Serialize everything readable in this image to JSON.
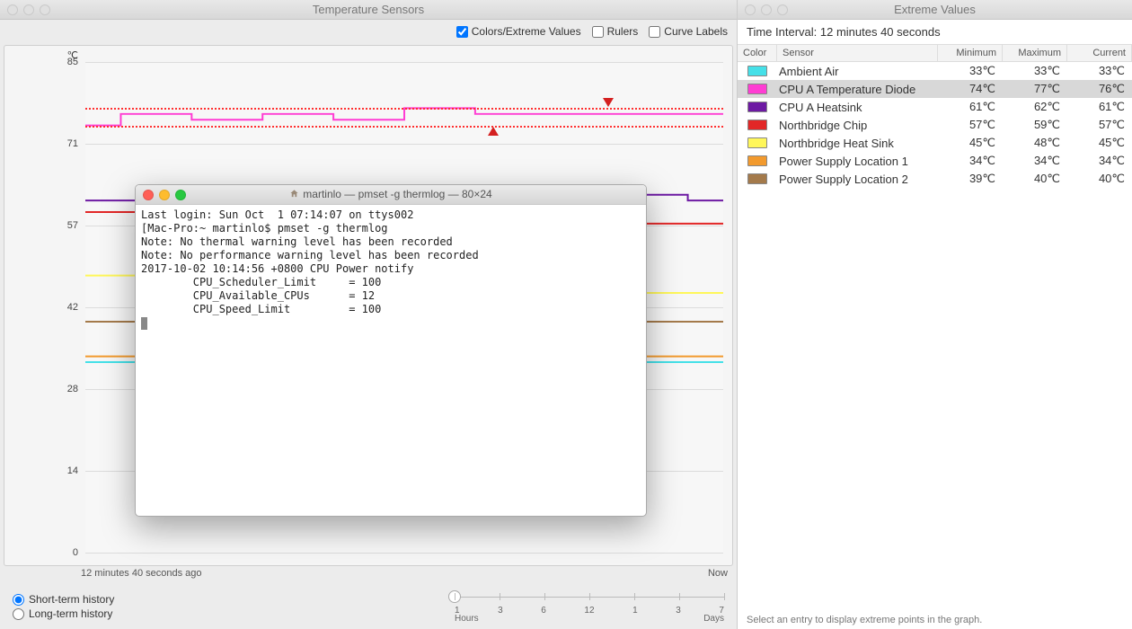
{
  "sensors_window": {
    "title": "Temperature Sensors",
    "checkboxes": {
      "colors_extreme": {
        "label": "Colors/Extreme Values",
        "checked": true
      },
      "rulers": {
        "label": "Rulers",
        "checked": false
      },
      "curve_labels": {
        "label": "Curve Labels",
        "checked": false
      }
    },
    "y_unit": "℃",
    "y_ticks": [
      "85",
      "71",
      "57",
      "42",
      "28",
      "14",
      "0"
    ],
    "x_left": "12 minutes 40 seconds ago",
    "x_right": "Now",
    "history": {
      "short": "Short-term history",
      "long": "Long-term history"
    },
    "timeline": {
      "hours_label": "Hours",
      "days_label": "Days",
      "ticks": [
        "1",
        "3",
        "6",
        "12",
        "1",
        "3",
        "7"
      ]
    }
  },
  "extreme_window": {
    "title": "Extreme Values",
    "interval_label": "Time Interval: 12 minutes 40 seconds",
    "columns": {
      "color": "Color",
      "sensor": "Sensor",
      "min": "Minimum",
      "max": "Maximum",
      "cur": "Current"
    },
    "rows": [
      {
        "color": "#45e0e8",
        "name": "Ambient Air",
        "min": "33℃",
        "max": "33℃",
        "cur": "33℃",
        "selected": false
      },
      {
        "color": "#ff3dd3",
        "name": "CPU A Temperature Diode",
        "min": "74℃",
        "max": "77℃",
        "cur": "76℃",
        "selected": true
      },
      {
        "color": "#6d1aa3",
        "name": "CPU A Heatsink",
        "min": "61℃",
        "max": "62℃",
        "cur": "61℃",
        "selected": false
      },
      {
        "color": "#e22727",
        "name": "Northbridge Chip",
        "min": "57℃",
        "max": "59℃",
        "cur": "57℃",
        "selected": false
      },
      {
        "color": "#fff75a",
        "name": "Northbridge Heat Sink",
        "min": "45℃",
        "max": "48℃",
        "cur": "45℃",
        "selected": false
      },
      {
        "color": "#f29a2e",
        "name": "Power Supply Location 1",
        "min": "34℃",
        "max": "34℃",
        "cur": "34℃",
        "selected": false
      },
      {
        "color": "#a47a4b",
        "name": "Power Supply Location 2",
        "min": "39℃",
        "max": "40℃",
        "cur": "40℃",
        "selected": false
      }
    ],
    "footer": "Select an entry to display extreme points in the graph."
  },
  "terminal": {
    "title": "martinlo — pmset -g thermlog — 80×24",
    "lines": [
      "Last login: Sun Oct  1 07:14:07 on ttys002",
      "[Mac-Pro:~ martinlo$ pmset -g thermlog",
      "Note: No thermal warning level has been recorded",
      "Note: No performance warning level has been recorded",
      "2017-10-02 10:14:56 +0800 CPU Power notify",
      "        CPU_Scheduler_Limit     = 100",
      "        CPU_Available_CPUs      = 12",
      "        CPU_Speed_Limit         = 100"
    ]
  },
  "chart_data": {
    "type": "line",
    "ylabel": "℃",
    "ylim": [
      0,
      85
    ],
    "x_range": "12 minutes 40 seconds",
    "thresholds": {
      "low": 74,
      "high": 77
    },
    "markers": {
      "min_at_x_percent": 64,
      "max_at_x_percent": 82
    },
    "series": [
      {
        "name": "Ambient Air",
        "color": "#45e0e8",
        "values": [
          33,
          33,
          33,
          33,
          33,
          33,
          33,
          33,
          33,
          33
        ]
      },
      {
        "name": "CPU A Temperature Diode",
        "color": "#ff3dd3",
        "values": [
          74,
          76,
          75,
          76,
          75,
          77,
          76,
          76,
          76,
          76
        ]
      },
      {
        "name": "CPU A Heatsink",
        "color": "#6d1aa3",
        "values": [
          61,
          61,
          62,
          61,
          61,
          62,
          61,
          61,
          62,
          61
        ]
      },
      {
        "name": "Northbridge Chip",
        "color": "#e22727",
        "values": [
          59,
          59,
          58,
          58,
          58,
          57,
          57,
          57,
          57,
          57
        ]
      },
      {
        "name": "Northbridge Heat Sink",
        "color": "#fff75a",
        "values": [
          48,
          48,
          47,
          47,
          46,
          46,
          46,
          45,
          45,
          45
        ]
      },
      {
        "name": "Power Supply Location 1",
        "color": "#f29a2e",
        "values": [
          34,
          34,
          34,
          34,
          34,
          34,
          34,
          34,
          34,
          34
        ]
      },
      {
        "name": "Power Supply Location 2",
        "color": "#a47a4b",
        "values": [
          40,
          40,
          40,
          40,
          40,
          39,
          39,
          40,
          40,
          40
        ]
      }
    ]
  }
}
